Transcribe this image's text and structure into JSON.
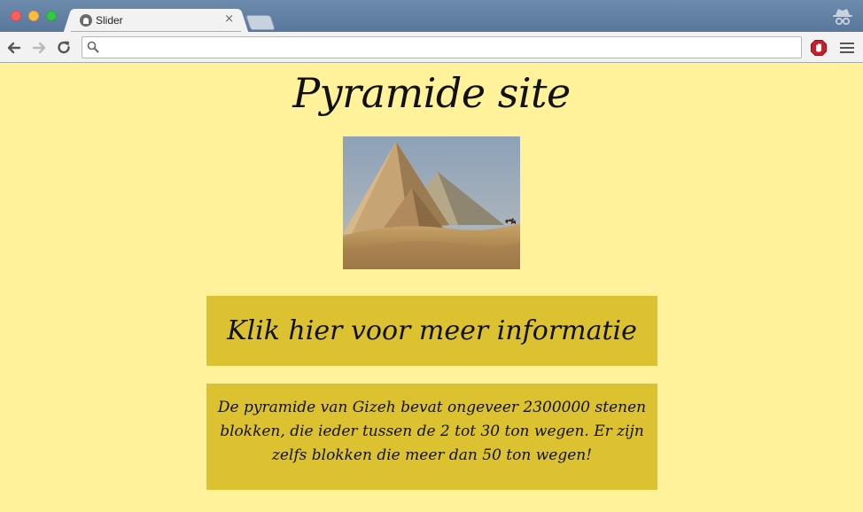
{
  "browser": {
    "tab_title": "Slider",
    "tab_close": "×",
    "address_value": "",
    "address_placeholder": "",
    "icons": {
      "back": "arrow-left-icon",
      "forward": "arrow-right-icon",
      "reload": "reload-icon",
      "search": "search-icon",
      "extension": "adblock-icon",
      "menu": "hamburger-menu-icon",
      "incognito": "incognito-icon"
    }
  },
  "page": {
    "title": "Pyramide site",
    "image_alt": "Piramides van Gizeh",
    "info_button_label": "Klik hier voor meer informatie",
    "info_text": "De pyramide van Gizeh bevat ongeveer 2300000 stenen blokken, die ieder tussen de 2 tot 30 ton wegen. Er zijn zelfs blokken die meer dan 50 ton wegen!"
  },
  "colors": {
    "page_background": "#fff29b",
    "panel_background": "#dcc230",
    "text": "#111111"
  }
}
